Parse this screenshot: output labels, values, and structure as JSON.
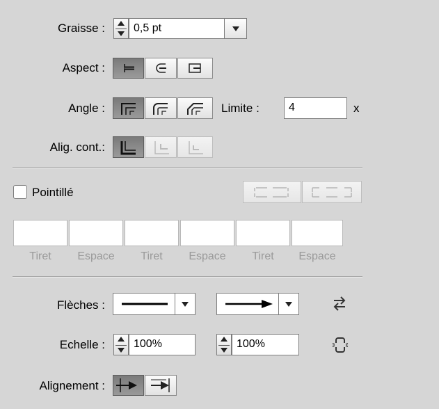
{
  "stroke": {
    "weight": {
      "label": "Graisse :",
      "value": "0,5 pt"
    },
    "cap": {
      "label": "Aspect :"
    },
    "corner": {
      "label": "Angle :",
      "limit_label": "Limite :",
      "limit_value": "4",
      "limit_suffix": "x"
    },
    "align": {
      "label": "Alig. cont.:"
    }
  },
  "dashed": {
    "checkbox_label": "Pointillé",
    "checked": false,
    "dash_captions": [
      "Tiret",
      "Espace",
      "Tiret",
      "Espace",
      "Tiret",
      "Espace"
    ]
  },
  "arrows": {
    "label": "Flèches :",
    "scale_label": "Echelle :",
    "scale_start": "100%",
    "scale_end": "100%",
    "alignment_label": "Alignement :"
  },
  "colors": {
    "panel_bg": "#d6d6d6",
    "selected_segment": "#7a7a7a",
    "disabled_text": "#9a9a9a"
  }
}
